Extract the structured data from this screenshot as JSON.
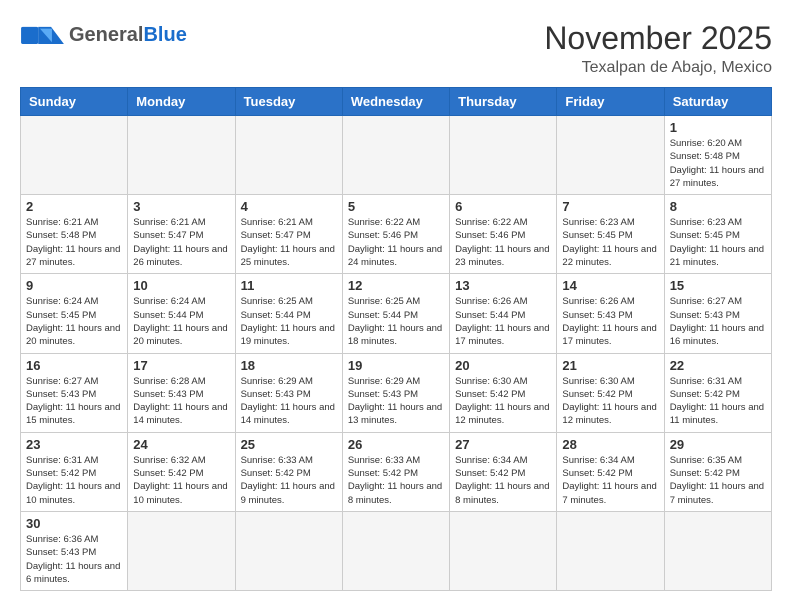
{
  "header": {
    "logo_general": "General",
    "logo_blue": "Blue",
    "month": "November 2025",
    "location": "Texalpan de Abajo, Mexico"
  },
  "weekdays": [
    "Sunday",
    "Monday",
    "Tuesday",
    "Wednesday",
    "Thursday",
    "Friday",
    "Saturday"
  ],
  "days": {
    "d1": {
      "num": "1",
      "sunrise": "6:20 AM",
      "sunset": "5:48 PM",
      "daylight": "11 hours and 27 minutes."
    },
    "d2": {
      "num": "2",
      "sunrise": "6:21 AM",
      "sunset": "5:48 PM",
      "daylight": "11 hours and 27 minutes."
    },
    "d3": {
      "num": "3",
      "sunrise": "6:21 AM",
      "sunset": "5:47 PM",
      "daylight": "11 hours and 26 minutes."
    },
    "d4": {
      "num": "4",
      "sunrise": "6:21 AM",
      "sunset": "5:47 PM",
      "daylight": "11 hours and 25 minutes."
    },
    "d5": {
      "num": "5",
      "sunrise": "6:22 AM",
      "sunset": "5:46 PM",
      "daylight": "11 hours and 24 minutes."
    },
    "d6": {
      "num": "6",
      "sunrise": "6:22 AM",
      "sunset": "5:46 PM",
      "daylight": "11 hours and 23 minutes."
    },
    "d7": {
      "num": "7",
      "sunrise": "6:23 AM",
      "sunset": "5:45 PM",
      "daylight": "11 hours and 22 minutes."
    },
    "d8": {
      "num": "8",
      "sunrise": "6:23 AM",
      "sunset": "5:45 PM",
      "daylight": "11 hours and 21 minutes."
    },
    "d9": {
      "num": "9",
      "sunrise": "6:24 AM",
      "sunset": "5:45 PM",
      "daylight": "11 hours and 20 minutes."
    },
    "d10": {
      "num": "10",
      "sunrise": "6:24 AM",
      "sunset": "5:44 PM",
      "daylight": "11 hours and 20 minutes."
    },
    "d11": {
      "num": "11",
      "sunrise": "6:25 AM",
      "sunset": "5:44 PM",
      "daylight": "11 hours and 19 minutes."
    },
    "d12": {
      "num": "12",
      "sunrise": "6:25 AM",
      "sunset": "5:44 PM",
      "daylight": "11 hours and 18 minutes."
    },
    "d13": {
      "num": "13",
      "sunrise": "6:26 AM",
      "sunset": "5:44 PM",
      "daylight": "11 hours and 17 minutes."
    },
    "d14": {
      "num": "14",
      "sunrise": "6:26 AM",
      "sunset": "5:43 PM",
      "daylight": "11 hours and 17 minutes."
    },
    "d15": {
      "num": "15",
      "sunrise": "6:27 AM",
      "sunset": "5:43 PM",
      "daylight": "11 hours and 16 minutes."
    },
    "d16": {
      "num": "16",
      "sunrise": "6:27 AM",
      "sunset": "5:43 PM",
      "daylight": "11 hours and 15 minutes."
    },
    "d17": {
      "num": "17",
      "sunrise": "6:28 AM",
      "sunset": "5:43 PM",
      "daylight": "11 hours and 14 minutes."
    },
    "d18": {
      "num": "18",
      "sunrise": "6:29 AM",
      "sunset": "5:43 PM",
      "daylight": "11 hours and 14 minutes."
    },
    "d19": {
      "num": "19",
      "sunrise": "6:29 AM",
      "sunset": "5:43 PM",
      "daylight": "11 hours and 13 minutes."
    },
    "d20": {
      "num": "20",
      "sunrise": "6:30 AM",
      "sunset": "5:42 PM",
      "daylight": "11 hours and 12 minutes."
    },
    "d21": {
      "num": "21",
      "sunrise": "6:30 AM",
      "sunset": "5:42 PM",
      "daylight": "11 hours and 12 minutes."
    },
    "d22": {
      "num": "22",
      "sunrise": "6:31 AM",
      "sunset": "5:42 PM",
      "daylight": "11 hours and 11 minutes."
    },
    "d23": {
      "num": "23",
      "sunrise": "6:31 AM",
      "sunset": "5:42 PM",
      "daylight": "11 hours and 10 minutes."
    },
    "d24": {
      "num": "24",
      "sunrise": "6:32 AM",
      "sunset": "5:42 PM",
      "daylight": "11 hours and 10 minutes."
    },
    "d25": {
      "num": "25",
      "sunrise": "6:33 AM",
      "sunset": "5:42 PM",
      "daylight": "11 hours and 9 minutes."
    },
    "d26": {
      "num": "26",
      "sunrise": "6:33 AM",
      "sunset": "5:42 PM",
      "daylight": "11 hours and 8 minutes."
    },
    "d27": {
      "num": "27",
      "sunrise": "6:34 AM",
      "sunset": "5:42 PM",
      "daylight": "11 hours and 8 minutes."
    },
    "d28": {
      "num": "28",
      "sunrise": "6:34 AM",
      "sunset": "5:42 PM",
      "daylight": "11 hours and 7 minutes."
    },
    "d29": {
      "num": "29",
      "sunrise": "6:35 AM",
      "sunset": "5:42 PM",
      "daylight": "11 hours and 7 minutes."
    },
    "d30": {
      "num": "30",
      "sunrise": "6:36 AM",
      "sunset": "5:43 PM",
      "daylight": "11 hours and 6 minutes."
    }
  }
}
